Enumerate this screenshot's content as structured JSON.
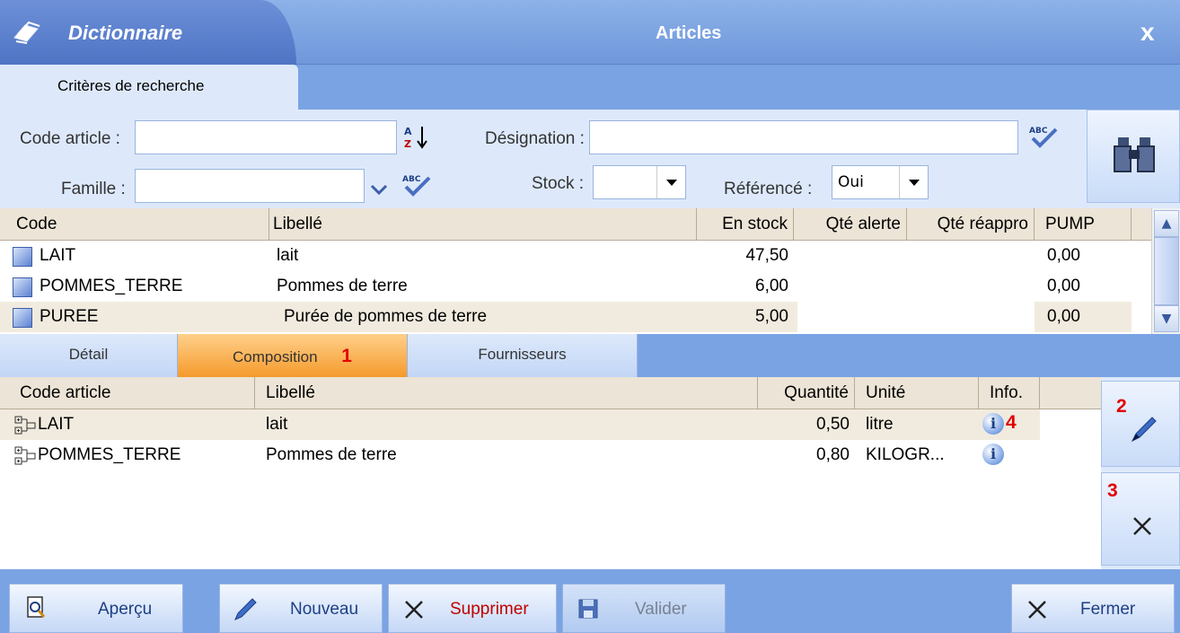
{
  "window": {
    "app_tab": "Dictionnaire",
    "title": "Articles",
    "close": "x"
  },
  "criteria_tab": "Critères de recherche",
  "filters": {
    "code_label": "Code article :",
    "code_value": "",
    "designation_label": "Désignation :",
    "designation_value": "",
    "famille_label": "Famille :",
    "famille_value": "",
    "stock_label": "Stock :",
    "stock_value": "",
    "reference_label": "Référencé :",
    "reference_value": "Oui"
  },
  "articles": {
    "headers": [
      "Code",
      "Libellé",
      "En stock",
      "Qté alerte",
      "Qté réappro",
      "PUMP"
    ],
    "rows": [
      {
        "code": "LAIT",
        "libelle": "lait",
        "stock": "47,50",
        "alerte": "",
        "reappro": "",
        "pump": "0,00"
      },
      {
        "code": "POMMES_TERRE",
        "libelle": "Pommes de terre",
        "stock": "6,00",
        "alerte": "",
        "reappro": "",
        "pump": "0,00"
      },
      {
        "code": "PUREE",
        "libelle": "Purée de pommes de terre",
        "stock": "5,00",
        "alerte": "",
        "reappro": "",
        "pump": "0,00"
      }
    ]
  },
  "detail_tabs": {
    "detail": "Détail",
    "composition": "Composition",
    "composition_marker": "1",
    "fournisseurs": "Fournisseurs"
  },
  "composition": {
    "headers": [
      "Code article",
      "Libellé",
      "Quantité",
      "Unité",
      "Info."
    ],
    "rows": [
      {
        "code": "LAIT",
        "libelle": "lait",
        "quantite": "0,50",
        "unite": "litre",
        "marker": "4"
      },
      {
        "code": "POMMES_TERRE",
        "libelle": "Pommes de terre",
        "quantite": "0,80",
        "unite": "KILOGR..."
      }
    ]
  },
  "side_buttons": {
    "edit_marker": "2",
    "delete_marker": "3"
  },
  "bottom": {
    "apercu": "Aperçu",
    "nouveau": "Nouveau",
    "supprimer": "Supprimer",
    "valider": "Valider",
    "fermer": "Fermer"
  },
  "colors": {
    "accent_blue": "#7aa3e4",
    "active_tab": "#f59a2c",
    "marker_red": "#e10000",
    "supprimer_text": "#c00000"
  }
}
